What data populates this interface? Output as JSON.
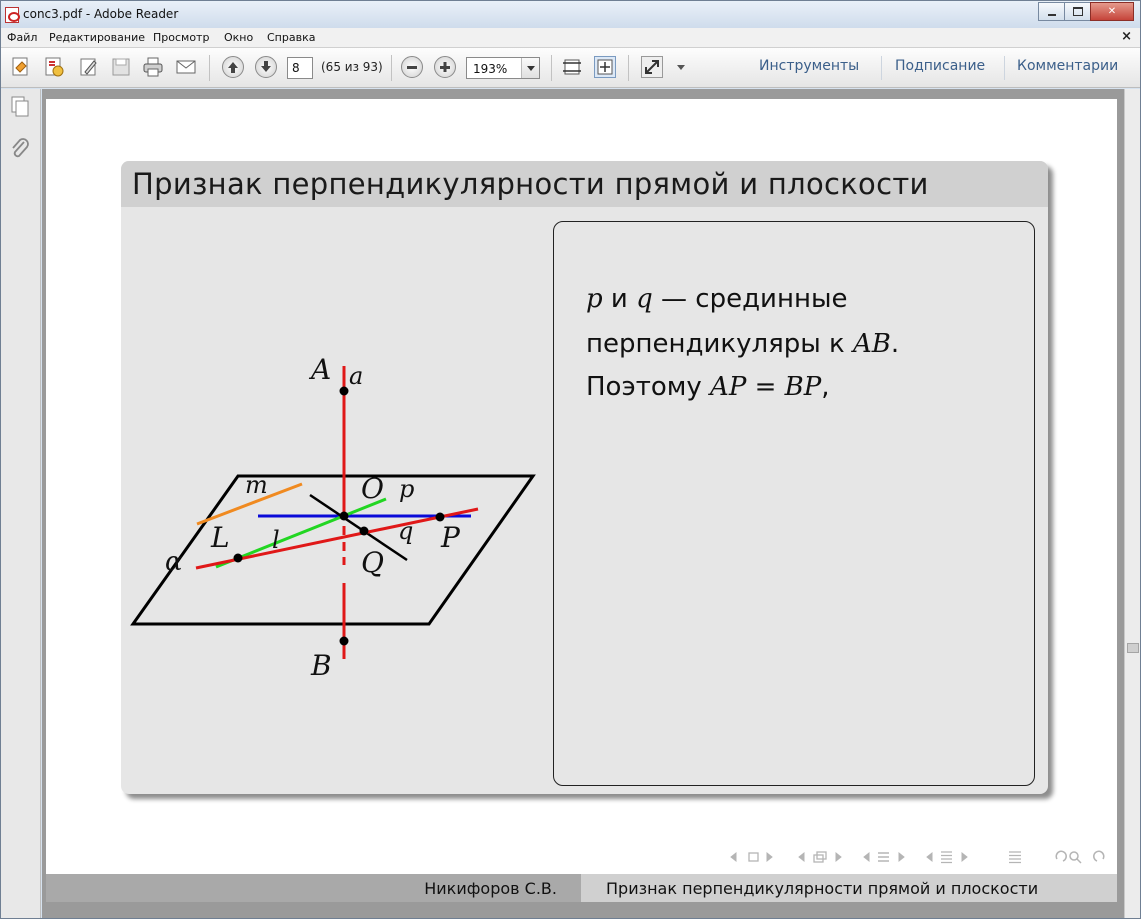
{
  "window": {
    "title": "conc3.pdf - Adobe Reader"
  },
  "menu": {
    "items": [
      "Файл",
      "Редактирование",
      "Просмотр",
      "Окно",
      "Справка"
    ],
    "close_glyph": "×"
  },
  "toolbar": {
    "page_number": "8",
    "page_count": "(65 из 93)",
    "zoom": "193%",
    "links": [
      "Инструменты",
      "Подписание",
      "Комментарии"
    ],
    "icons": [
      "create-pdf-icon",
      "open-icon",
      "edit-icon",
      "save-icon",
      "print-icon",
      "email-icon",
      "page-up-icon",
      "page-down-icon",
      "zoom-out-icon",
      "zoom-in-icon",
      "fit-page-icon",
      "fit-width-icon",
      "full-screen-icon",
      "more-icon"
    ]
  },
  "navpane": {
    "icons": [
      "pages-icon",
      "attachments-icon"
    ]
  },
  "slide": {
    "title": "Признак перпендикулярности прямой и плоскости",
    "text_line1_rest": " и ",
    "text_line1_tail": " — срединные",
    "text_line2": "перпендикуляры к ",
    "text_line2_math": "AB",
    "text_line2_tail": ".",
    "text_line3": "Поэтому ",
    "text_line3_math": "AP",
    "text_line3_eq": " = ",
    "text_line3_math2": "BP",
    "text_line3_tail": ",",
    "var_p": "p",
    "var_q": "q",
    "figure_labels": {
      "A": "A",
      "a": "a",
      "B": "B",
      "O": "O",
      "p": "p",
      "m": "m",
      "L": "L",
      "l": "l",
      "q": "q",
      "P": "P",
      "Q": "Q",
      "alpha": "α"
    }
  },
  "footer": {
    "author": "Никифоров С.В.",
    "title": "Признак перпендикулярности прямой и плоскости"
  },
  "colors": {
    "red": "#e01818",
    "blue": "#0a0ad8",
    "green": "#22d622",
    "orange": "#f08a20",
    "black": "#000000",
    "link": "#3b5f8a"
  }
}
